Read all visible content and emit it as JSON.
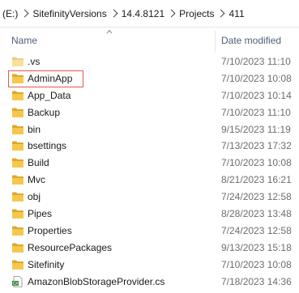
{
  "breadcrumb": {
    "items": [
      "(E:)",
      "SitefinityVersions",
      "14.4.8121",
      "Projects",
      "411"
    ]
  },
  "columns": {
    "name": "Name",
    "date_modified": "Date modified"
  },
  "colors": {
    "folder": "#f5c84c",
    "folder_dark": "#dca92f",
    "highlight": "#e8564a",
    "header_text": "#4c607a"
  },
  "files": [
    {
      "name": ".vs",
      "date": "7/10/2023 11:10",
      "type": "folder",
      "faded": true
    },
    {
      "name": "AdminApp",
      "date": "7/10/2023 10:08",
      "type": "folder",
      "highlighted": true
    },
    {
      "name": "App_Data",
      "date": "7/10/2023 10:14",
      "type": "folder"
    },
    {
      "name": "Backup",
      "date": "7/10/2023 11:10",
      "type": "folder"
    },
    {
      "name": "bin",
      "date": "9/15/2023 11:19",
      "type": "folder"
    },
    {
      "name": "bsettings",
      "date": "7/13/2023 17:32",
      "type": "folder"
    },
    {
      "name": "Build",
      "date": "7/10/2023 10:08",
      "type": "folder"
    },
    {
      "name": "Mvc",
      "date": "8/21/2023 16:21",
      "type": "folder"
    },
    {
      "name": "obj",
      "date": "7/24/2023 12:58",
      "type": "folder"
    },
    {
      "name": "Pipes",
      "date": "8/28/2023 13:48",
      "type": "folder"
    },
    {
      "name": "Properties",
      "date": "7/24/2023 12:58",
      "type": "folder"
    },
    {
      "name": "ResourcePackages",
      "date": "9/13/2023 15:18",
      "type": "folder"
    },
    {
      "name": "Sitefinity",
      "date": "7/10/2023 10:08",
      "type": "folder"
    },
    {
      "name": "AmazonBlobStorageProvider.cs",
      "date": "7/18/2023 14:36",
      "type": "cs-file"
    }
  ]
}
